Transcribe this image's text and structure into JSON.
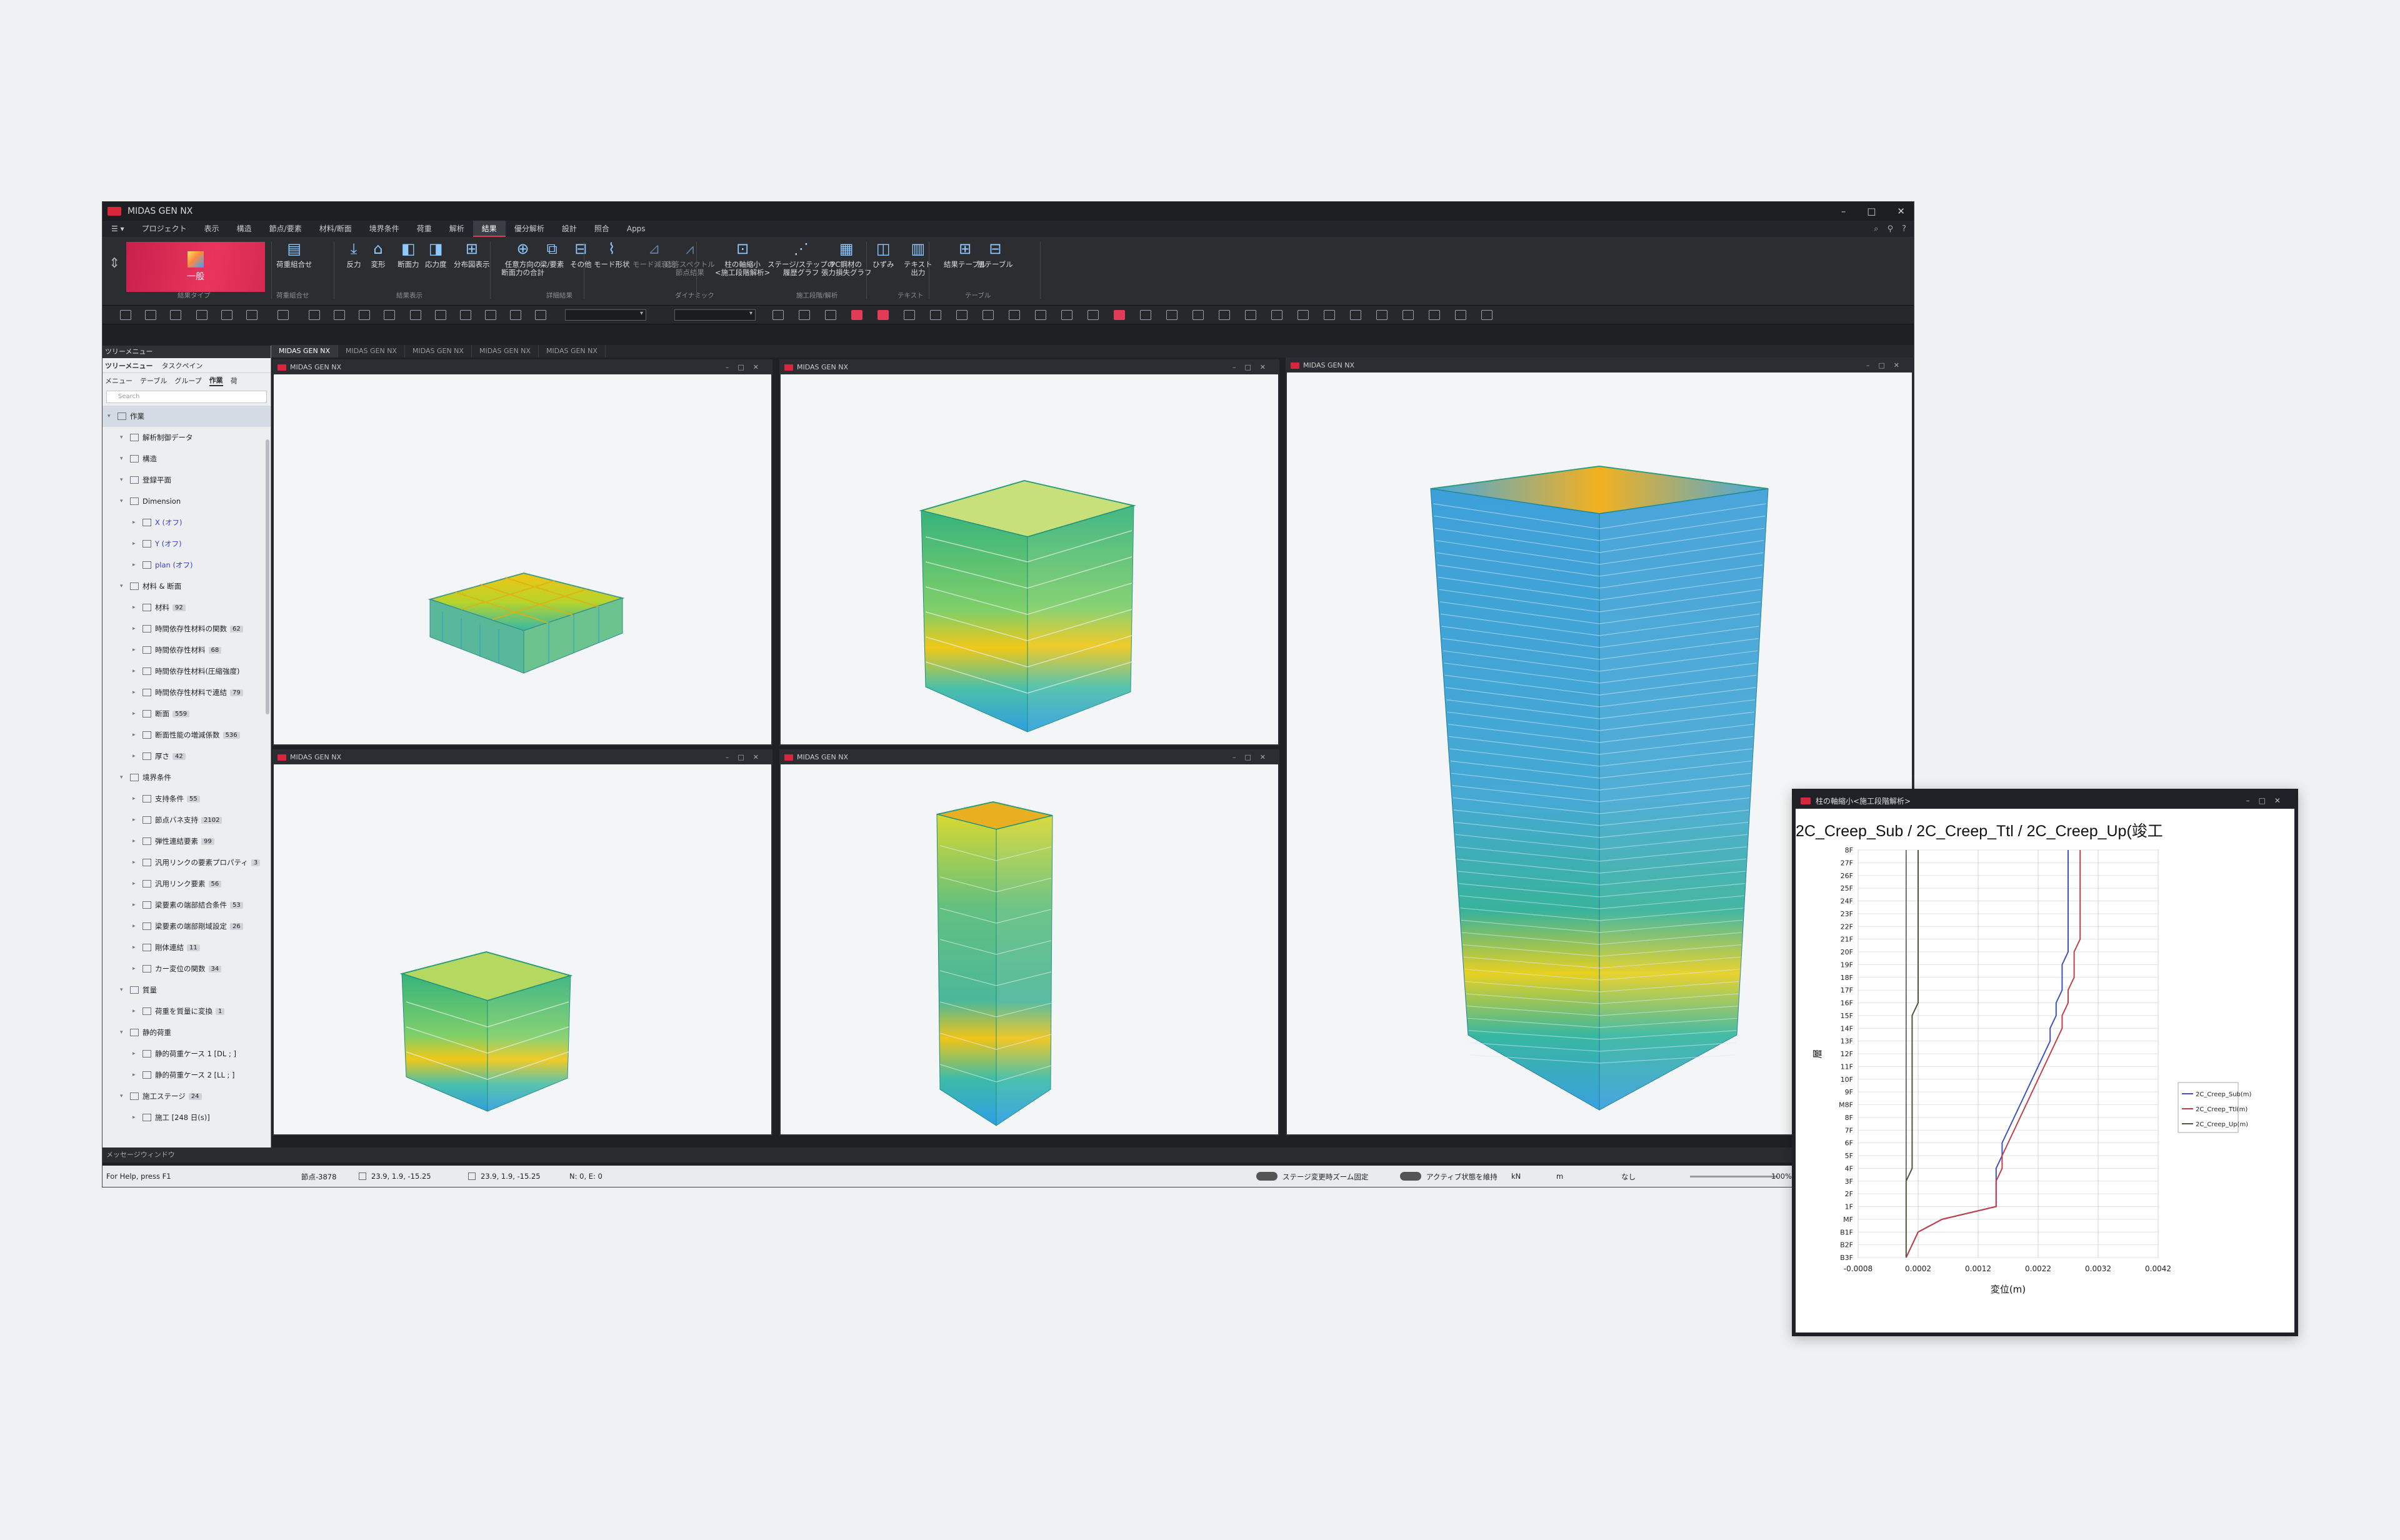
{
  "app": {
    "title": "MIDAS GEN NX",
    "window_controls": [
      "–",
      "□",
      "✕"
    ]
  },
  "menu": [
    "プロジェクト",
    "表示",
    "構造",
    "節点/要素",
    "材料/断面",
    "境界条件",
    "荷重",
    "解析",
    "結果",
    "優分解析",
    "設計",
    "照合",
    "Apps"
  ],
  "menu_active": "結果",
  "ribbon": {
    "big": {
      "label": "一般",
      "group": "結果タイプ"
    },
    "buttons": [
      {
        "label": "荷重組合せ",
        "icon": "load-combination-icon"
      },
      {
        "label": "反力",
        "icon": "reaction-icon"
      },
      {
        "label": "変形",
        "icon": "deformation-icon"
      },
      {
        "label": "断面力",
        "icon": "section-force-icon"
      },
      {
        "label": "応力度",
        "icon": "stress-icon"
      },
      {
        "label": "分布図表示",
        "icon": "distribution-icon"
      },
      {
        "label": "任意方向の\n断面力の合計",
        "icon": "section-sum-icon"
      },
      {
        "label": "梁/要素",
        "icon": "beam-icon"
      },
      {
        "label": "その他",
        "icon": "other-icon"
      },
      {
        "label": "モード形状",
        "icon": "mode-shape-icon"
      },
      {
        "label": "モード減衰比",
        "icon": "damping-icon"
      },
      {
        "label": "応答スペクトル\n節点結果",
        "icon": "response-spectrum-icon"
      },
      {
        "label": "柱の軸縮小\n<施工段階解析>",
        "icon": "column-shortening-icon"
      },
      {
        "label": "ステージ/ステップの\n履歴グラフ",
        "icon": "history-graph-icon"
      },
      {
        "label": "PC鋼材の\n張力損失グラフ",
        "icon": "pc-tendon-icon"
      },
      {
        "label": "ひずみ",
        "icon": "strain-icon"
      },
      {
        "label": "テキスト\n出力",
        "icon": "text-output-icon"
      },
      {
        "label": "結果テーブル",
        "icon": "result-table-icon"
      },
      {
        "label": "層テーブル",
        "icon": "story-table-icon"
      }
    ],
    "groups": [
      "荷重組合せ",
      "結果表示",
      "詳細結果",
      "ダイナミック",
      "施工段階/解析",
      "テキスト",
      "テーブル"
    ]
  },
  "doc_tabs": [
    "MIDAS GEN NX",
    "MIDAS GEN NX",
    "MIDAS GEN NX",
    "MIDAS GEN NX",
    "MIDAS GEN NX"
  ],
  "sidebar": {
    "header": "ツリーメニュー",
    "tabs_top": [
      "ツリーメニュー",
      "タスクペイン"
    ],
    "tabs": [
      "メニュー",
      "テーブル",
      "グループ",
      "作業",
      "荷"
    ],
    "search_placeholder": "Search",
    "items": [
      {
        "label": "作業",
        "level": 0,
        "hl": true
      },
      {
        "label": "解析制御データ",
        "level": 1
      },
      {
        "label": "構造",
        "level": 1
      },
      {
        "label": "登録平面",
        "level": 1
      },
      {
        "label": "Dimension",
        "level": 1
      },
      {
        "label": "X (オフ)",
        "level": 2,
        "blue": true
      },
      {
        "label": "Y (オフ)",
        "level": 2,
        "blue": true
      },
      {
        "label": "plan (オフ)",
        "level": 2,
        "blue": true
      },
      {
        "label": "材料 & 断面",
        "level": 1
      },
      {
        "label": "材料",
        "level": 2,
        "count": "92"
      },
      {
        "label": "時間依存性材料の関数",
        "level": 2,
        "count": "62"
      },
      {
        "label": "時間依存性材料",
        "level": 2,
        "count": "68"
      },
      {
        "label": "時間依存性材料(圧縮強度)",
        "level": 2
      },
      {
        "label": "時間依存性材料で連結",
        "level": 2,
        "count": "79"
      },
      {
        "label": "断面",
        "level": 2,
        "count": "559"
      },
      {
        "label": "断面性能の増減係数",
        "level": 2,
        "count": "536"
      },
      {
        "label": "厚さ",
        "level": 2,
        "count": "42"
      },
      {
        "label": "境界条件",
        "level": 1
      },
      {
        "label": "支持条件",
        "level": 2,
        "count": "55"
      },
      {
        "label": "節点バネ支持",
        "level": 2,
        "count": "2102"
      },
      {
        "label": "弾性連結要素",
        "level": 2,
        "count": "99"
      },
      {
        "label": "汎用リンクの要素プロパティ",
        "level": 2,
        "count": "3"
      },
      {
        "label": "汎用リンク要素",
        "level": 2,
        "count": "56"
      },
      {
        "label": "梁要素の端部結合条件",
        "level": 2,
        "count": "53"
      },
      {
        "label": "梁要素の端部剛域設定",
        "level": 2,
        "count": "26"
      },
      {
        "label": "剛体連結",
        "level": 2,
        "count": "11"
      },
      {
        "label": "カー変位の関数",
        "level": 2,
        "count": "34"
      },
      {
        "label": "質量",
        "level": 1
      },
      {
        "label": "荷重を質量に変換",
        "level": 2,
        "count": "1"
      },
      {
        "label": "静的荷重",
        "level": 1
      },
      {
        "label": "静的荷重ケース 1 [DL ; ]",
        "level": 2
      },
      {
        "label": "静的荷重ケース 2 [LL ; ]",
        "level": 2
      },
      {
        "label": "施工ステージ",
        "level": 1,
        "count": "24"
      },
      {
        "label": "施工 [248 日(s)]",
        "level": 2
      }
    ]
  },
  "viewports": [
    {
      "title": "MIDAS GEN NX"
    },
    {
      "title": "MIDAS GEN NX"
    },
    {
      "title": "MIDAS GEN NX"
    },
    {
      "title": "MIDAS GEN NX"
    },
    {
      "title": "MIDAS GEN NX"
    }
  ],
  "message_bar": "メッセージウィンドウ",
  "status": {
    "help": "For Help, press F1",
    "node": "節点-3878",
    "coord1": "23.9, 1.9, -15.25",
    "coord2": "23.9, 1.9, -15.25",
    "ne": "N: 0, E: 0",
    "toggle1": "ステージ変更時ズーム固定",
    "toggle2": "アクティブ状態を維持",
    "unit_force": "kN",
    "unit_len": "m",
    "none": "なし",
    "zoom": "100%"
  },
  "graph": {
    "window_title": "柱の軸縮小<施工段階解析>",
    "title": "2C_Creep_Sub / 2C_Creep_Ttl / 2C_Creep_Up(竣工",
    "xlabel": "変位(m)",
    "ylabel": "層"
  },
  "chart_data": {
    "type": "line",
    "title": "2C_Creep_Sub / 2C_Creep_Ttl / 2C_Creep_Up(竣工",
    "xlabel": "変位(m)",
    "ylabel": "層",
    "xlim": [
      -0.0008,
      0.0042
    ],
    "xticks": [
      "-0.0008",
      "0.0002",
      "0.0012",
      "0.0022",
      "0.0032",
      "0.0042"
    ],
    "categories": [
      "B3F",
      "B2F",
      "B1F",
      "MF",
      "1F",
      "2F",
      "3F",
      "4F",
      "5F",
      "6F",
      "7F",
      "8F",
      "M8F",
      "9F",
      "10F",
      "11F",
      "12F",
      "13F",
      "14F",
      "15F",
      "16F",
      "17F",
      "18F",
      "19F",
      "20F",
      "21F",
      "22F",
      "23F",
      "24F",
      "25F",
      "26F",
      "27F",
      "8F"
    ],
    "series": [
      {
        "name": "2C_Creep_Sub(m)",
        "color": "#3f52c4",
        "values": [
          0.0,
          0.0001,
          0.0002,
          0.0006,
          0.0015,
          0.0015,
          0.0015,
          0.0015,
          0.0016,
          0.0016,
          0.0017,
          0.0018,
          0.0019,
          0.002,
          0.0021,
          0.0022,
          0.0023,
          0.0024,
          0.0024,
          0.0025,
          0.0025,
          0.0026,
          0.0026,
          0.0026,
          0.0027,
          0.0027,
          0.0027,
          0.0027,
          0.0027,
          0.0027,
          0.0027,
          0.0027,
          0.0027
        ]
      },
      {
        "name": "2C_Creep_Ttl(m)",
        "color": "#c0404a",
        "values": [
          0.0,
          0.0001,
          0.0002,
          0.0006,
          0.0015,
          0.0015,
          0.0015,
          0.0016,
          0.0016,
          0.0017,
          0.0018,
          0.0019,
          0.002,
          0.0021,
          0.0022,
          0.0023,
          0.0024,
          0.0025,
          0.0026,
          0.0026,
          0.0027,
          0.0027,
          0.0028,
          0.0028,
          0.0028,
          0.0029,
          0.0029,
          0.0029,
          0.0029,
          0.0029,
          0.0029,
          0.0029,
          0.0029
        ]
      },
      {
        "name": "2C_Creep_Up(m)",
        "color": "#4a5a3a",
        "values": [
          0.0,
          0.0,
          0.0,
          0.0,
          0.0,
          0.0,
          0.0,
          0.0001,
          0.0001,
          0.0001,
          0.0001,
          0.0001,
          0.0001,
          0.0001,
          0.0001,
          0.0001,
          0.0001,
          0.0001,
          0.0001,
          0.0001,
          0.0002,
          0.0002,
          0.0002,
          0.0002,
          0.0002,
          0.0002,
          0.0002,
          0.0002,
          0.0002,
          0.0002,
          0.0002,
          0.0002,
          0.0002
        ]
      }
    ],
    "grid": true,
    "legend": "right"
  }
}
